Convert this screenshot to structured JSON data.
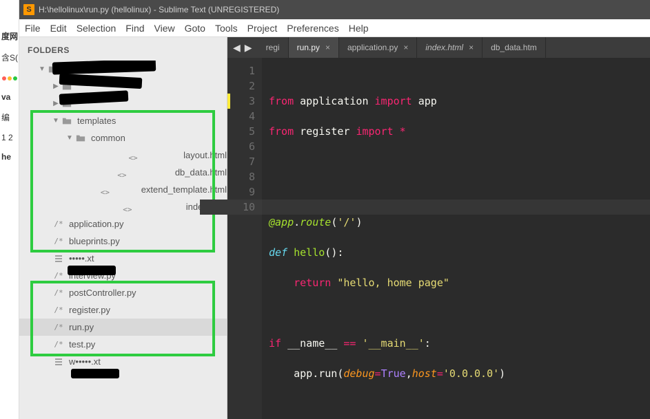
{
  "left_strip": {
    "frag0": "度网",
    "frag1": "含S(",
    "frag2": "va",
    "frag3": "编",
    "frag4": "1 2",
    "frag5": "he"
  },
  "title": "H:\\hellolinux\\run.py (hellolinux) - Sublime Text (UNREGISTERED)",
  "app_icon_letter": "S",
  "menu": [
    "File",
    "Edit",
    "Selection",
    "Find",
    "View",
    "Goto",
    "Tools",
    "Project",
    "Preferences",
    "Help"
  ],
  "sidebar_title": "FOLDERS",
  "tree": {
    "redacted_top": [
      " ",
      " ",
      " "
    ],
    "templates": "templates",
    "common": "common",
    "layout": "layout.html",
    "dbdata": "db_data.html",
    "extend": "extend_template.html",
    "index": "index.html",
    "application": "application.py",
    "blueprints": "blueprints.py",
    "redacted_mid": "•••••.xt",
    "interview": "interview.py",
    "postcontroller": "postController.py",
    "register": "register.py",
    "run": "run.py",
    "test": "test.py",
    "redacted_bot": "w•••••.xt"
  },
  "tabs": [
    {
      "label": "regi",
      "close": "",
      "active": false,
      "italic": false
    },
    {
      "label": "run.py",
      "close": "×",
      "active": true,
      "italic": false
    },
    {
      "label": "application.py",
      "close": "×",
      "active": false,
      "italic": false
    },
    {
      "label": "index.html",
      "close": "×",
      "active": false,
      "italic": true
    },
    {
      "label": "db_data.htm",
      "close": "",
      "active": false,
      "italic": false
    }
  ],
  "nav_left": "◀",
  "nav_right": "▶",
  "gutter": [
    "1",
    "2",
    "3",
    "4",
    "5",
    "6",
    "7",
    "8",
    "9",
    "10"
  ],
  "code": {
    "tokens": {
      "from": "from",
      "import": "import",
      "star": "*",
      "at": "@",
      "dot": ".",
      "route": "route",
      "lpar": "(",
      "rpar": ")",
      "slash": "'/'",
      "def": "def",
      "hello": "hello",
      "colon": ":",
      "return": "return",
      "hellostr": "\"hello, home page\"",
      "if": "if",
      "name": "__name__",
      "eq": "==",
      "main": "'__main__'",
      "app": "app",
      "run": "run",
      "debug": "debug",
      "assign": "=",
      "true": "True",
      "comma": ",",
      "host": "host",
      "ip": "'0.0.0.0'",
      "application": "application",
      "register": "register"
    }
  }
}
